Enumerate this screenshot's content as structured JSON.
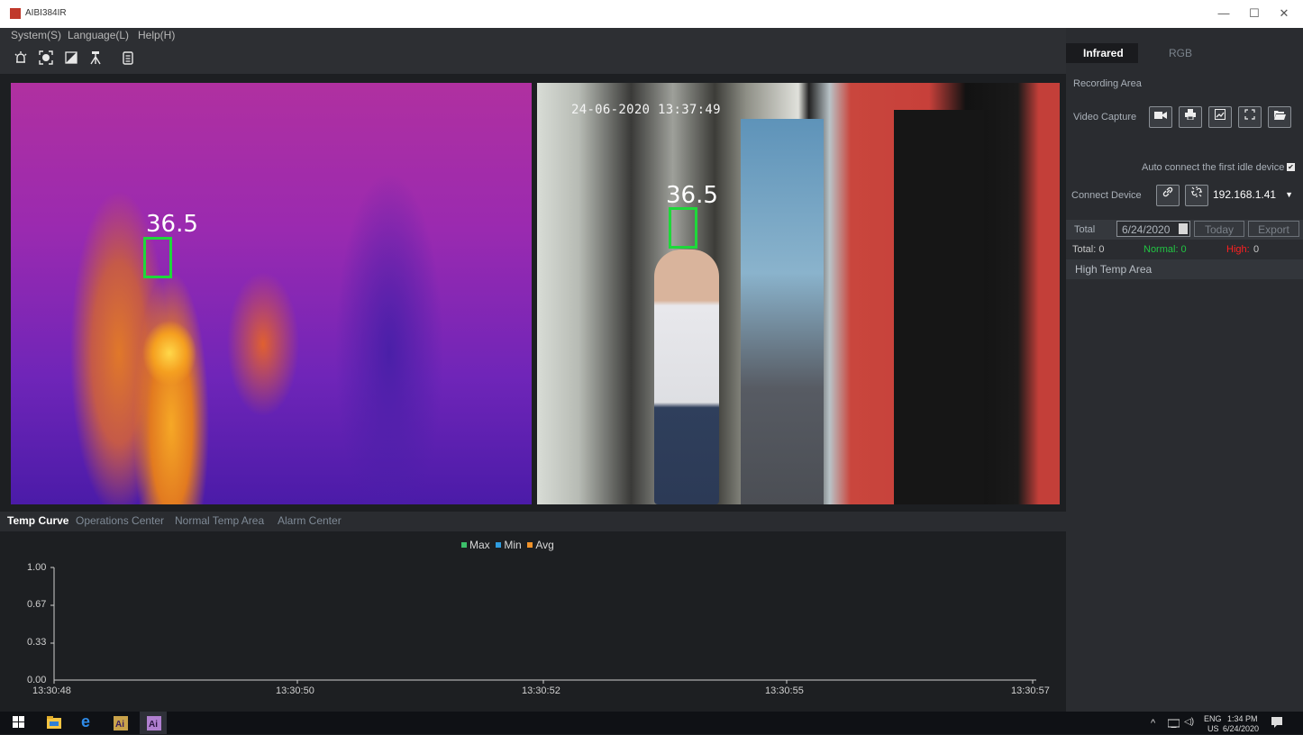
{
  "window": {
    "title": "AIBI384IR",
    "min": "—",
    "max": "☐",
    "close": "✕"
  },
  "menu": [
    "System(S)",
    "Language(L)",
    "Help(H)"
  ],
  "toolbar_icons": [
    "alarm-icon",
    "camera-focus-icon",
    "palette-icon",
    "tripod-icon",
    "clipboard-icon"
  ],
  "video": {
    "ir_temp": "36.5",
    "rgb_temp": "36.5",
    "timestamp": "24-06-2020 13:37:49"
  },
  "bottom_tabs": [
    "Temp Curve",
    "Operations Center",
    "Normal Temp Area",
    "Alarm Center"
  ],
  "chart_data": {
    "type": "line",
    "series": [
      {
        "name": "Max",
        "color": "#3cc06a",
        "values": []
      },
      {
        "name": "Min",
        "color": "#2f9de0",
        "values": []
      },
      {
        "name": "Avg",
        "color": "#f0922a",
        "values": []
      }
    ],
    "yticks": [
      "1.00",
      "0.67",
      "0.33",
      "0.00"
    ],
    "xticks": [
      "13:30:48",
      "13:30:50",
      "13:30:52",
      "13:30:55",
      "13:30:57"
    ],
    "ylim": [
      0,
      1
    ],
    "legend": "top"
  },
  "right": {
    "tabs": [
      "Infrared",
      "RGB"
    ],
    "recording_area": "Recording Area",
    "video_capture": "Video Capture",
    "auto_connect": "Auto connect the first idle device",
    "auto_connect_checked": true,
    "connect_device": "Connect Device",
    "ip": "192.168.1.41",
    "total_label": "Total",
    "date": "6/24/2020",
    "today": "Today",
    "export": "Export",
    "stats": {
      "total": "Total: 0",
      "normal": "Normal: 0",
      "high_label": "High:",
      "high_value": "0"
    },
    "high_temp_area": "High Temp Area"
  },
  "taskbar": {
    "lang": "ENG",
    "region": "US",
    "time": "1:34 PM",
    "date": "6/24/2020"
  }
}
